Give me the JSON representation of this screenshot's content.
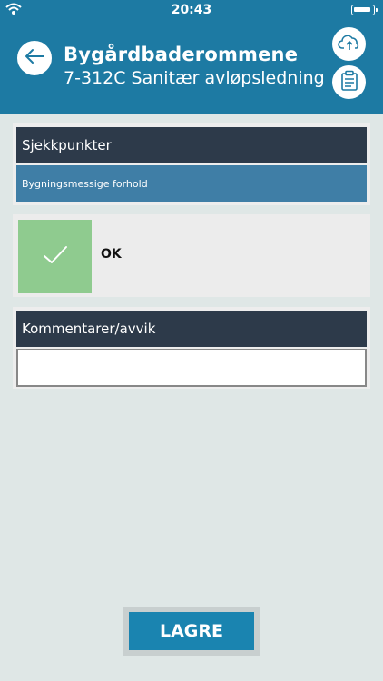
{
  "status": {
    "time": "20:43"
  },
  "header": {
    "title": "Bygårdbaderommene",
    "subtitle": "7-312C Sanitær avløpsledning",
    "color": "#1d7aa3"
  },
  "checkpoints": {
    "heading": "Sjekkpunkter",
    "category": "Bygningsmessige forhold"
  },
  "status_option": {
    "label": "OK",
    "color": "#8fcb8f"
  },
  "comments": {
    "heading": "Kommentarer/avvik",
    "value": "",
    "placeholder": ""
  },
  "footer": {
    "save_label": "LAGRE"
  },
  "icons": [
    "wifi-icon",
    "battery-icon",
    "back-arrow-icon",
    "cloud-upload-icon",
    "clipboard-icon",
    "checkmark-icon"
  ]
}
